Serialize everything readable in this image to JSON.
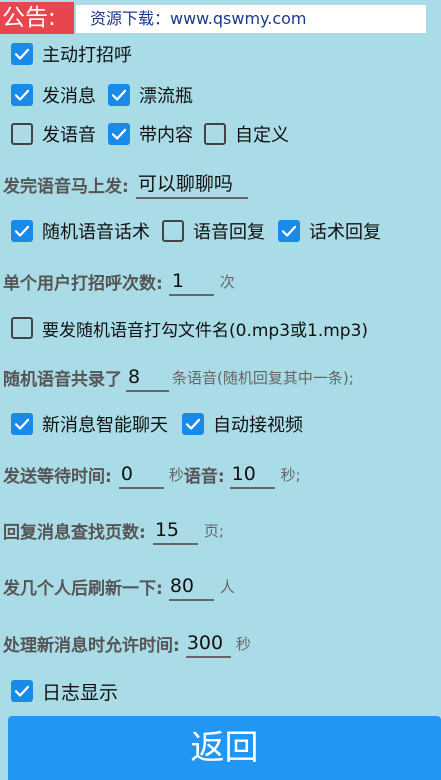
{
  "notice": {
    "label": "公告:",
    "text": "资源下载：www.qswmy.com"
  },
  "options": {
    "greet": {
      "label": "主动打招呼",
      "checked": true
    },
    "send_message": {
      "label": "发消息",
      "checked": true
    },
    "drift_bottle": {
      "label": "漂流瓶",
      "checked": true
    },
    "send_voice": {
      "label": "发语音",
      "checked": false
    },
    "with_content": {
      "label": "带内容",
      "checked": true
    },
    "custom": {
      "label": "自定义",
      "checked": false
    },
    "random_voice_script": {
      "label": "随机语音话术",
      "checked": true
    },
    "voice_reply": {
      "label": "语音回复",
      "checked": false
    },
    "script_reply": {
      "label": "话术回复",
      "checked": true
    },
    "random_voice_file": {
      "label": "要发随机语音打勾文件名(0.mp3或1.mp3)",
      "checked": false
    },
    "smart_chat": {
      "label": "新消息智能聊天",
      "checked": true
    },
    "auto_video": {
      "label": "自动接视频",
      "checked": true
    },
    "log_display": {
      "label": "日志显示",
      "checked": true
    }
  },
  "fields": {
    "voice_after": {
      "label": "发完语音马上发:",
      "value": "可以聊聊吗"
    },
    "greet_times": {
      "label": "单个用户打招呼次数:",
      "value": "1",
      "unit": "次"
    },
    "voice_count": {
      "label": "随机语音共录了",
      "value": "8",
      "unit": "条语音(随机回复其中一条);"
    },
    "wait_time": {
      "label": "发送等待时间:",
      "value": "0",
      "unit": "秒",
      "voice_label": "语音:",
      "voice_value": "10",
      "voice_unit": "秒;"
    },
    "reply_pages": {
      "label": "回复消息查找页数:",
      "value": "15",
      "unit": "页;"
    },
    "refresh_after": {
      "label": "发几个人后刷新一下:",
      "value": "80",
      "unit": "人"
    },
    "new_msg_time": {
      "label": "处理新消息时允许时间:",
      "value": "300",
      "unit": "秒"
    }
  },
  "back_button": {
    "label": "返回"
  }
}
